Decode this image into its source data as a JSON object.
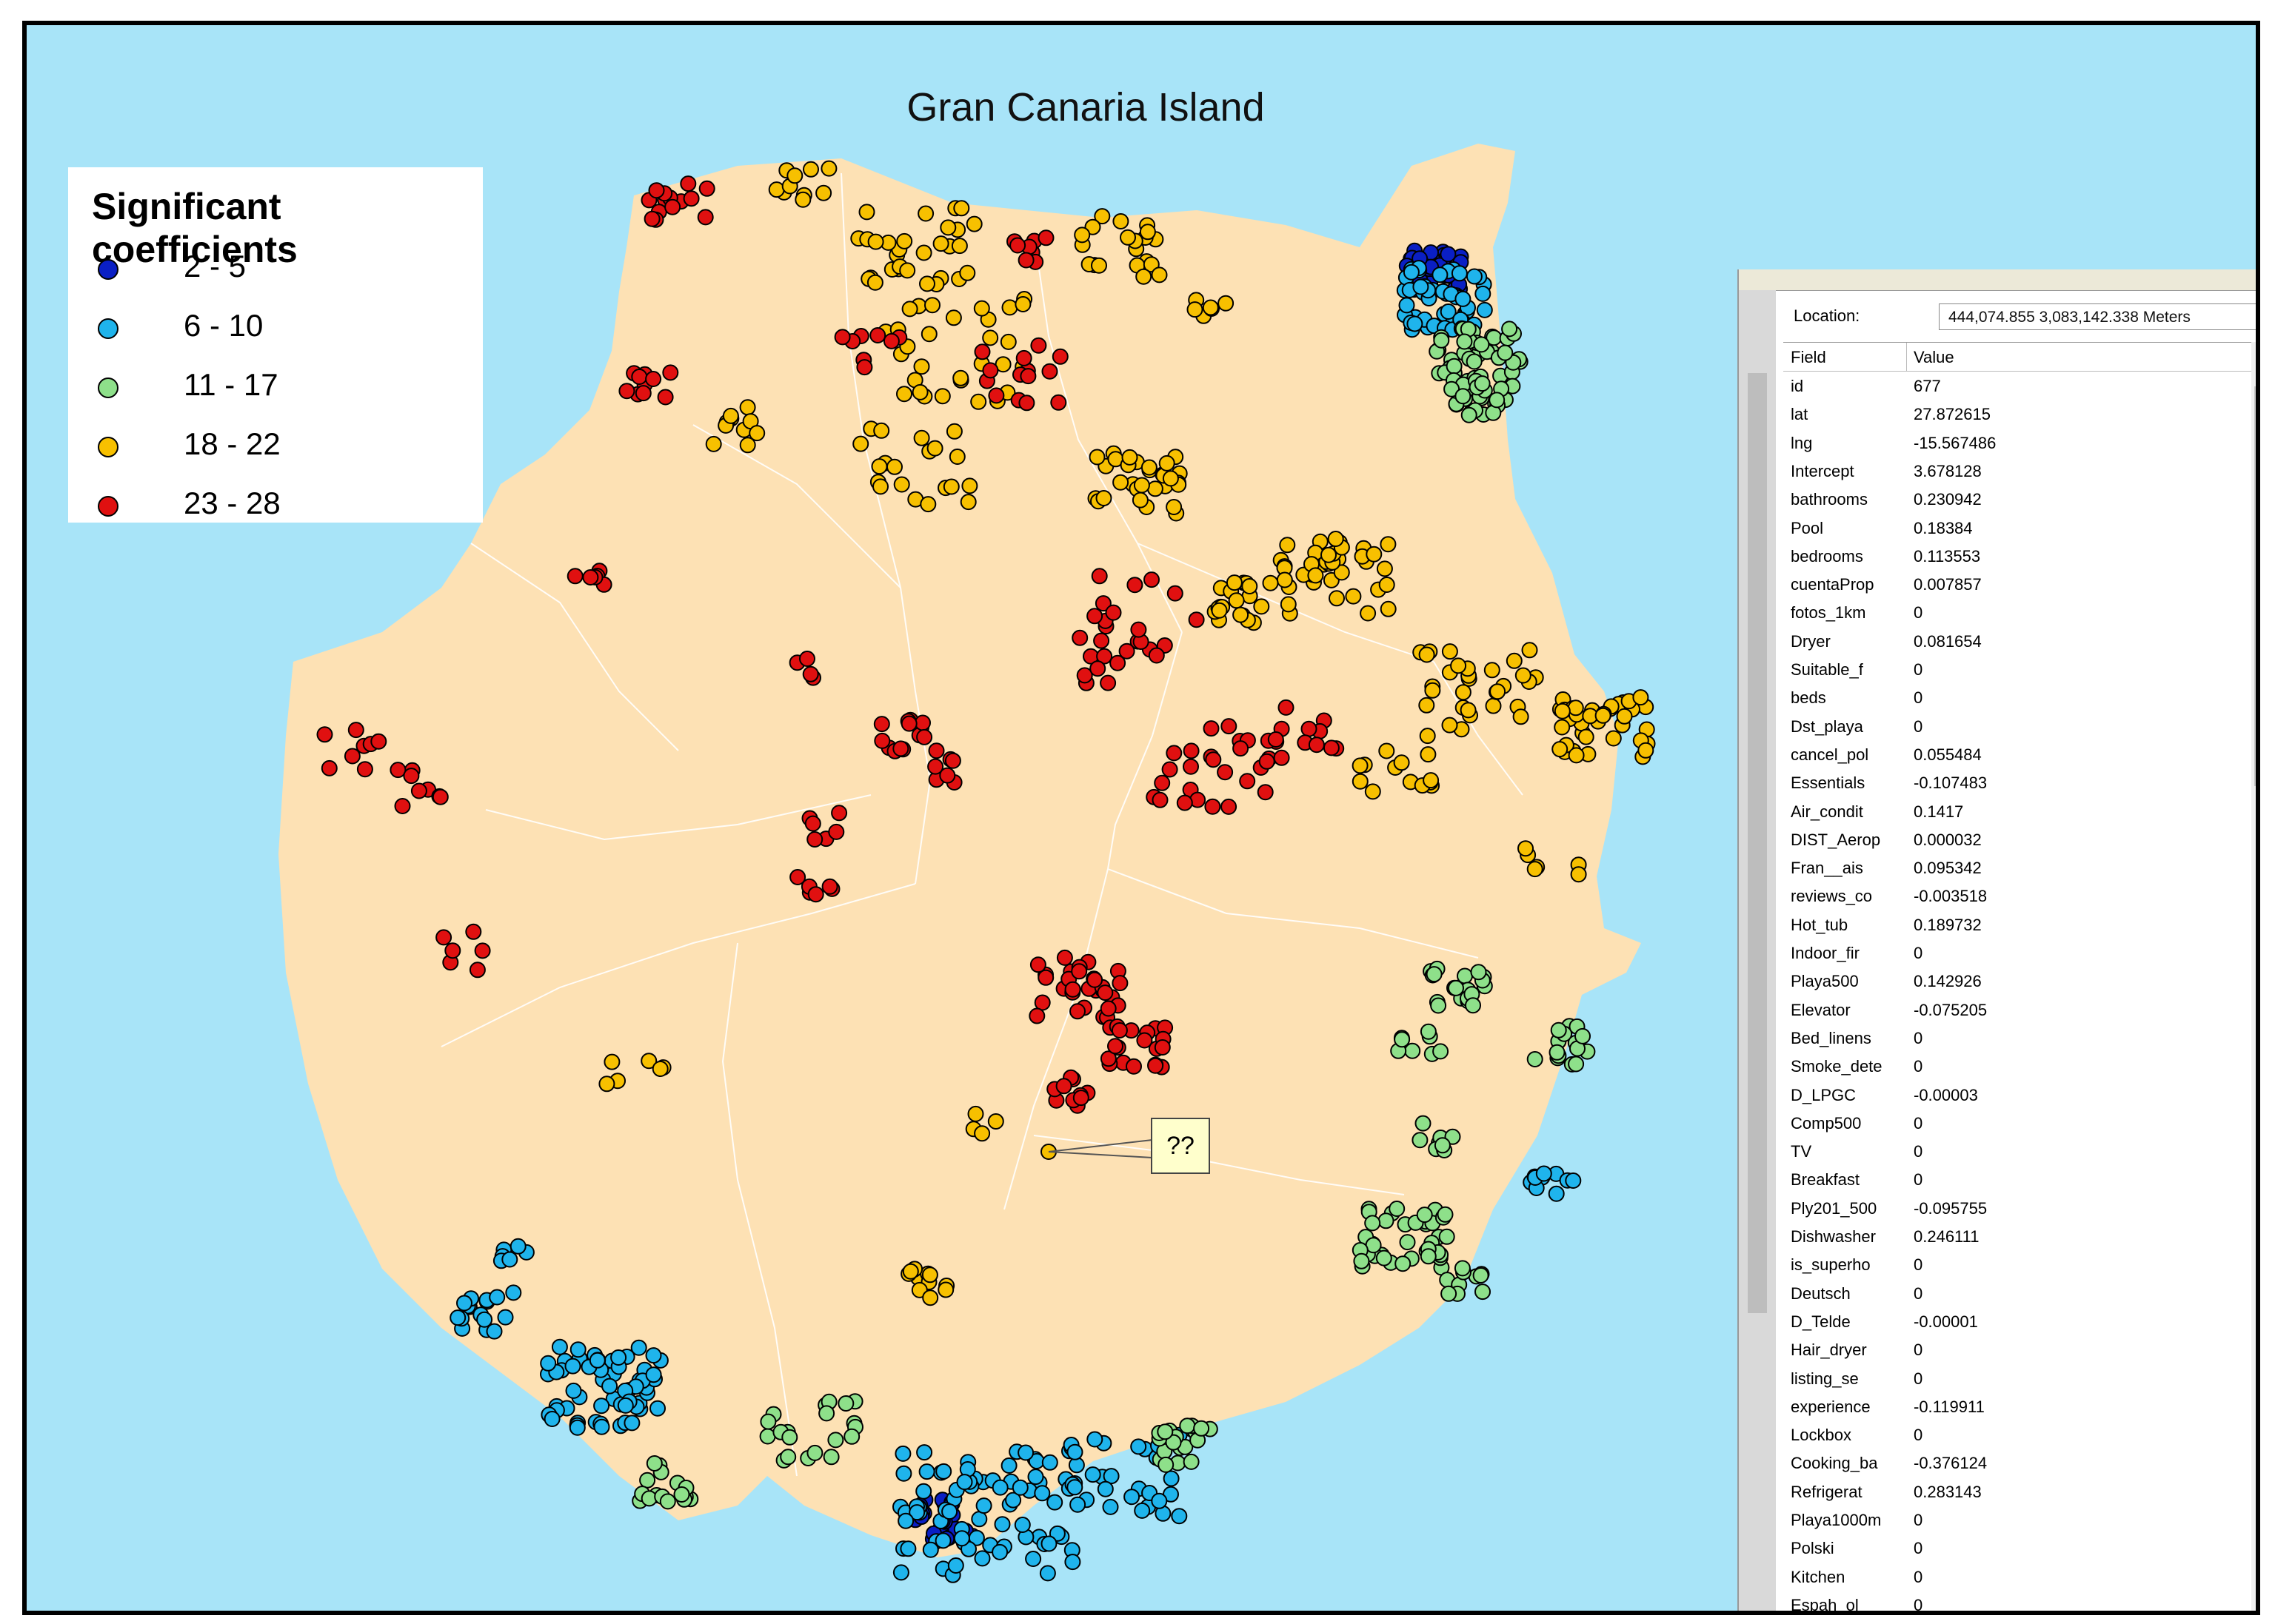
{
  "map": {
    "title": "Gran Canaria Island",
    "colors": {
      "sea": "#a8e4f8",
      "land": "#fde1b4",
      "boundary": "#ffffff",
      "outline": "#000000"
    }
  },
  "legend": {
    "title": "Significant coefficients",
    "classes": [
      {
        "label": "2 - 5",
        "color": "#0a1fc4"
      },
      {
        "label": "6 - 10",
        "color": "#1fb4ec"
      },
      {
        "label": "11 - 17",
        "color": "#8ee08a"
      },
      {
        "label": "18 - 22",
        "color": "#f7c000"
      },
      {
        "label": "23 - 28",
        "color": "#e01010"
      }
    ]
  },
  "callout": {
    "text": "??"
  },
  "identify": {
    "location_label": "Location:",
    "location_value": "444,074.855  3,083,142.338 Meters",
    "header_field": "Field",
    "header_value": "Value",
    "rows": [
      {
        "field": "id",
        "value": "677"
      },
      {
        "field": "lat",
        "value": "27.872615"
      },
      {
        "field": "lng",
        "value": "-15.567486"
      },
      {
        "field": "Intercept",
        "value": "3.678128"
      },
      {
        "field": "bathrooms",
        "value": "0.230942"
      },
      {
        "field": "Pool",
        "value": "0.18384"
      },
      {
        "field": "bedrooms",
        "value": "0.113553"
      },
      {
        "field": "cuentaProp",
        "value": "0.007857"
      },
      {
        "field": "fotos_1km",
        "value": "0"
      },
      {
        "field": "Dryer",
        "value": "0.081654"
      },
      {
        "field": "Suitable_f",
        "value": "0"
      },
      {
        "field": "beds",
        "value": "0"
      },
      {
        "field": "Dst_playa",
        "value": "0"
      },
      {
        "field": "cancel_pol",
        "value": "0.055484"
      },
      {
        "field": "Essentials",
        "value": "-0.107483"
      },
      {
        "field": "Air_condit",
        "value": "0.1417"
      },
      {
        "field": "DIST_Aerop",
        "value": "0.000032"
      },
      {
        "field": "Fran__ais",
        "value": "0.095342"
      },
      {
        "field": "reviews_co",
        "value": "-0.003518"
      },
      {
        "field": "Hot_tub",
        "value": "0.189732"
      },
      {
        "field": "Indoor_fir",
        "value": "0"
      },
      {
        "field": "Playa500",
        "value": "0.142926"
      },
      {
        "field": "Elevator",
        "value": "-0.075205"
      },
      {
        "field": "Bed_linens",
        "value": "0"
      },
      {
        "field": "Smoke_dete",
        "value": "0"
      },
      {
        "field": "D_LPGC",
        "value": "-0.00003"
      },
      {
        "field": "Comp500",
        "value": "0"
      },
      {
        "field": "TV",
        "value": "0"
      },
      {
        "field": "Breakfast",
        "value": "0"
      },
      {
        "field": "Ply201_500",
        "value": "-0.095755"
      },
      {
        "field": "Dishwasher",
        "value": "0.246111"
      },
      {
        "field": "is_superho",
        "value": "0"
      },
      {
        "field": "Deutsch",
        "value": "0"
      },
      {
        "field": "D_Telde",
        "value": "-0.00001"
      },
      {
        "field": "Hair_dryer",
        "value": "0"
      },
      {
        "field": "listing_se",
        "value": "0"
      },
      {
        "field": "experience",
        "value": "-0.119911"
      },
      {
        "field": "Lockbox",
        "value": "0"
      },
      {
        "field": "Cooking_ba",
        "value": "-0.376124"
      },
      {
        "field": "Refrigerat",
        "value": "0.283143"
      },
      {
        "field": "Playa1000m",
        "value": "0"
      },
      {
        "field": "Polski",
        "value": "0"
      },
      {
        "field": "Kitchen",
        "value": "0"
      },
      {
        "field": "Espah_ol",
        "value": "0"
      }
    ]
  }
}
